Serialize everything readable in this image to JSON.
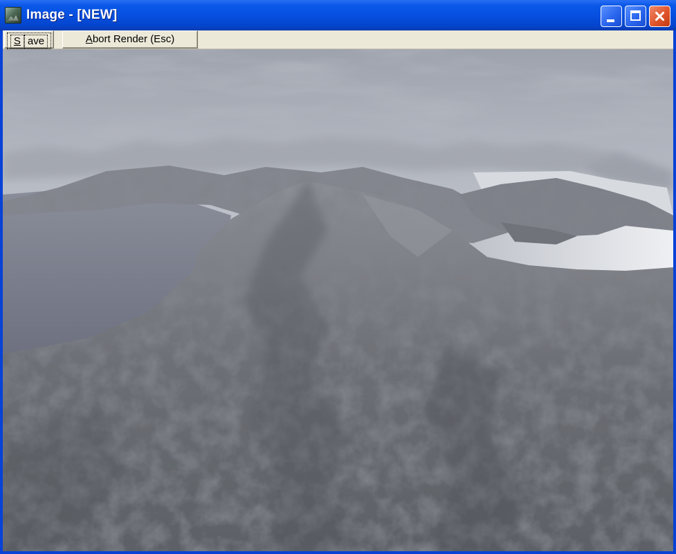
{
  "window": {
    "title": "Image - [NEW]",
    "controls": {
      "minimize": "minimize-icon",
      "maximize": "maximize-icon",
      "close": "close-icon"
    }
  },
  "toolbar": {
    "save_label": "Save",
    "abort_label": "Abort Render (Esc)"
  },
  "render": {
    "content": "rendered-terrain-image"
  },
  "colors": {
    "titlebar": "#0650e0",
    "toolbar": "#ece9d8",
    "close_button": "#e0552c"
  }
}
